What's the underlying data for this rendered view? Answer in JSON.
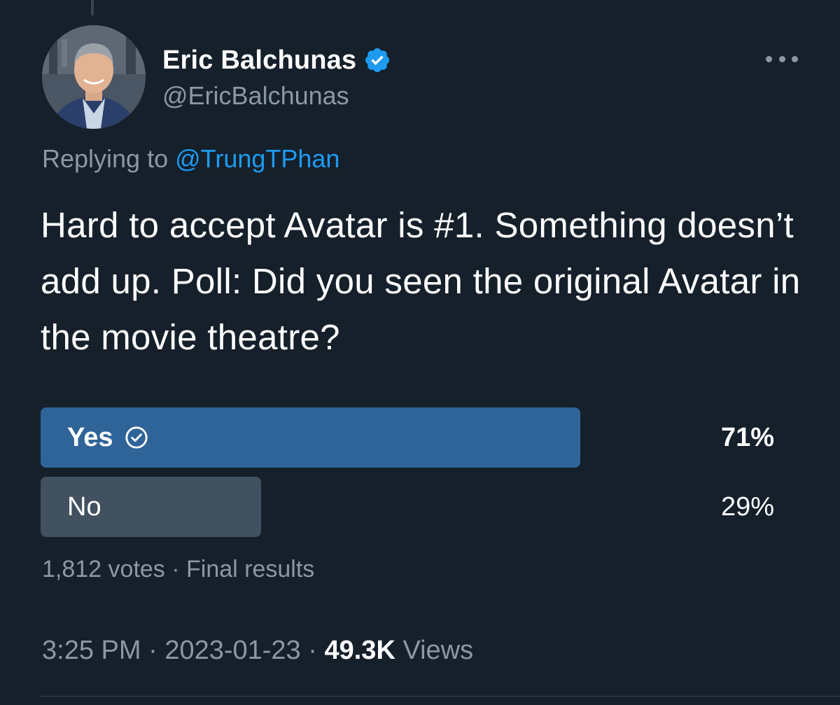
{
  "author": {
    "display_name": "Eric Balchunas",
    "handle": "@EricBalchunas",
    "verified": true
  },
  "reply": {
    "prefix": "Replying to",
    "mention": "@TrungTPhan"
  },
  "tweet": {
    "text": "Hard to accept Avatar is #1. Something doesn’t add up. Poll: Did you seen the original Avatar in the movie theatre?"
  },
  "poll": {
    "options": [
      {
        "label": "Yes",
        "percent_text": "71%",
        "percent": 71,
        "winner": true
      },
      {
        "label": "No",
        "percent_text": "29%",
        "percent": 29,
        "winner": false
      }
    ],
    "votes": "1,812 votes",
    "separator": " · ",
    "status": "Final results"
  },
  "meta": {
    "time": "3:25 PM",
    "date": "2023-01-23",
    "separator": " · ",
    "views_count": "49.3K",
    "views_label": "Views"
  },
  "colors": {
    "background": "#15202b",
    "accent": "#1d9bf0",
    "winner_bar": "#2f6499",
    "loser_bar": "#425160",
    "secondary_text": "#8b98a5"
  },
  "icons": {
    "verified": "verified-badge-icon",
    "more": "more-horizontal-icon",
    "winner_check": "check-circle-icon"
  }
}
